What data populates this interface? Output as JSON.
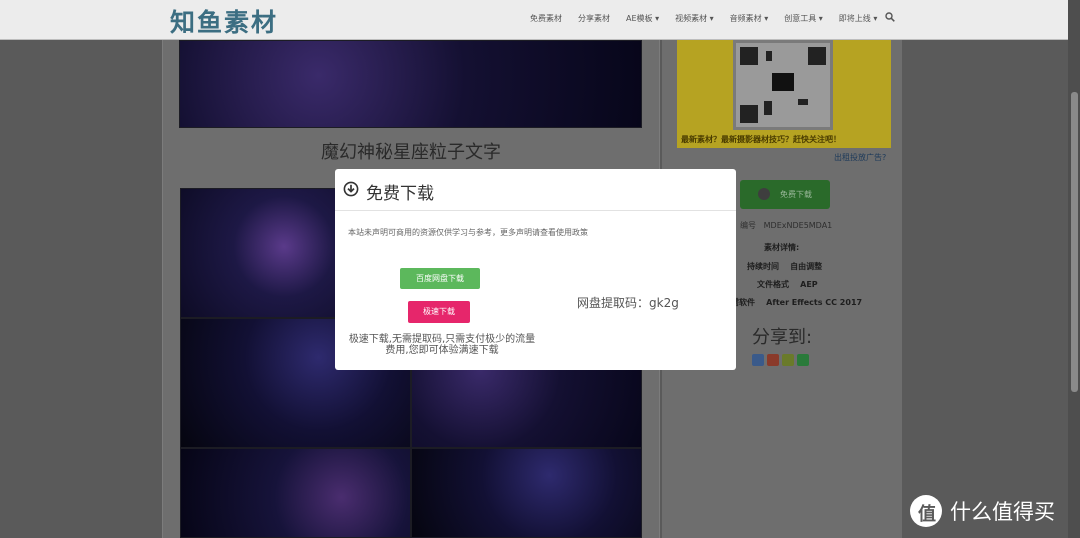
{
  "nav": {
    "logo": "知鱼素材",
    "items": [
      "免费素材",
      "分享素材",
      "AE模板 ▾",
      "视频素材 ▾",
      "音频素材 ▾",
      "创意工具 ▾",
      "即将上线 ▾"
    ]
  },
  "post": {
    "title": "魔幻神秘星座粒子文字"
  },
  "ad": {
    "slogan": "最新素材？最新摄影器材技巧？赶快关注吧！",
    "link": "出租投放广告?"
  },
  "sidebar": {
    "download_label": "免费下载",
    "code_label": "编号",
    "code_value": "MDExNDE5MDA1",
    "details_label": "素材详情:",
    "duration_label": "持续时间",
    "duration_value": "自由调整",
    "format_label": "文件格式",
    "format_value": "AEP",
    "software_label": "所需软件",
    "software_value": "After Effects CC 2017",
    "share_title": "分享到:"
  },
  "modal": {
    "title": "免费下载",
    "description": "本站未声明可商用的资源仅供学习与参考，更多声明请查看使用政策",
    "baidu_button": "百度网盘下载",
    "fast_button": "极速下载",
    "extract_code": "网盘提取码：gk2g",
    "fast_note": "极速下载,无需提取码,只需支付极少的流量费用,您即可体验满速下载"
  },
  "brand": {
    "logo_glyph": "值",
    "text": "什么值得买"
  },
  "colors": {
    "baidu_button": "#5cb85c",
    "fast_button": "#e6266b",
    "logo": "#3c6e82"
  }
}
